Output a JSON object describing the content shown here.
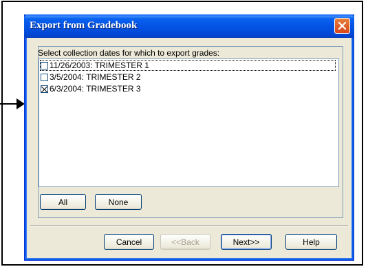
{
  "window": {
    "title": "Export from Gradebook"
  },
  "group": {
    "label": "Select collection dates for which to export grades:"
  },
  "list": {
    "items": [
      {
        "label": "11/26/2003: TRIMESTER 1",
        "checked": false
      },
      {
        "label": "3/5/2004: TRIMESTER 2",
        "checked": false
      },
      {
        "label": "6/3/2004: TRIMESTER 3",
        "checked": true
      }
    ]
  },
  "buttons": {
    "all": "All",
    "none": "None",
    "cancel": "Cancel",
    "back": "<<Back",
    "next": "Next>>",
    "help": "Help"
  },
  "icons": {
    "close": "close-icon",
    "arrow": "pointer-arrow-icon"
  },
  "colors": {
    "titlebar": "#0554e4",
    "dialog_bg": "#ece9d8",
    "close_btn": "#d9471b"
  }
}
